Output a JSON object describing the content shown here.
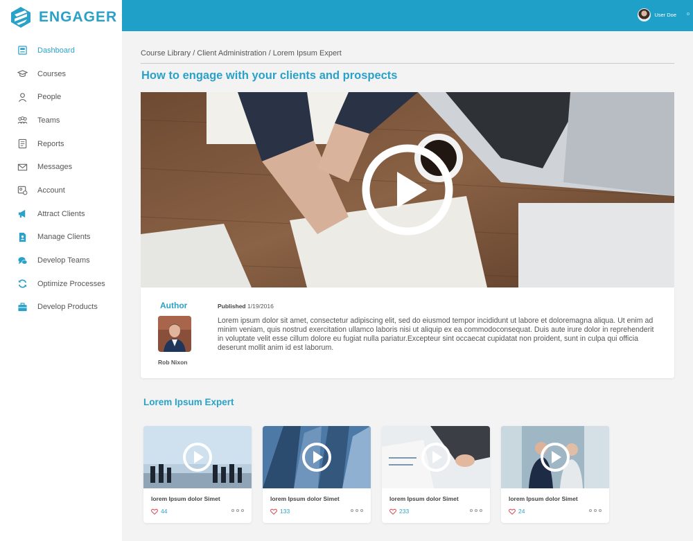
{
  "brand": {
    "name": "ENGAGER",
    "accent": "#2aa1c8",
    "header_color": "#1fa0c9"
  },
  "user": {
    "name": "User Doe"
  },
  "sidebar": {
    "items": [
      {
        "label": "Dashboard",
        "icon": "dashboard-icon",
        "active": true
      },
      {
        "label": "Courses",
        "icon": "graduation-cap-icon"
      },
      {
        "label": "People",
        "icon": "person-icon"
      },
      {
        "label": "Teams",
        "icon": "team-icon"
      },
      {
        "label": "Reports",
        "icon": "report-icon"
      },
      {
        "label": "Messages",
        "icon": "envelope-icon"
      },
      {
        "label": "Account",
        "icon": "account-icon"
      },
      {
        "label": "Attract Clients",
        "icon": "megaphone-icon"
      },
      {
        "label": "Manage Clients",
        "icon": "client-file-icon"
      },
      {
        "label": "Develop Teams",
        "icon": "chat-bubbles-icon"
      },
      {
        "label": "Optimize Processes",
        "icon": "sync-icon"
      },
      {
        "label": "Develop Products",
        "icon": "briefcase-icon"
      }
    ]
  },
  "breadcrumb": "Course Library / Client Administration / Lorem Ipsum Expert",
  "page_title": "How to engage with your clients and prospects",
  "course": {
    "author_heading": "Author",
    "author_name": "Rob Nixon",
    "published_label": "Published",
    "published_date": "1/19/2016",
    "description": "Lorem ipsum dolor sit amet, consectetur adipiscing elit, sed do eiusmod tempor incididunt ut labore et doloremagna aliqua. Ut enim ad minim veniam, quis nostrud exercitation ullamco laboris nisi ut aliquip ex ea commodoconsequat. Duis aute irure dolor in reprehenderit in voluptate velit esse cillum dolore eu fugiat nulla pariatur.Excepteur sint occaecat cupidatat non proident, sunt in culpa qui officia deserunt mollit anim id est laborum."
  },
  "section_title": "Lorem Ipsum Expert",
  "videos": [
    {
      "title": "lorem Ipsum dolor Simet",
      "likes": "44"
    },
    {
      "title": "lorem Ipsum dolor Simet",
      "likes": "133"
    },
    {
      "title": "lorem Ipsum dolor Simet",
      "likes": "233"
    },
    {
      "title": "lorem Ipsum dolor Simet",
      "likes": "24"
    }
  ]
}
